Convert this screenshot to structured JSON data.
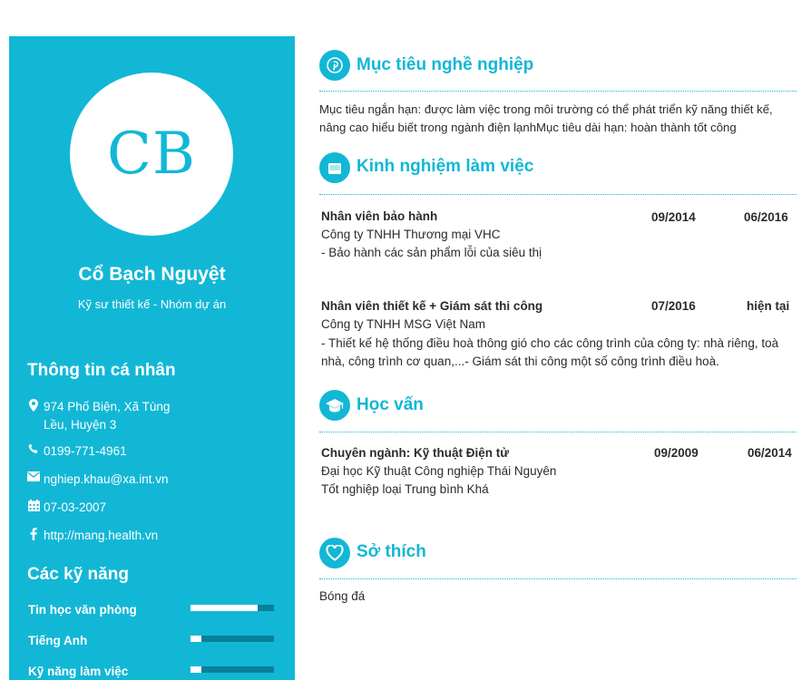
{
  "profile": {
    "initials": "CB",
    "name": "Cổ Bạch Nguyệt",
    "role": "Kỹ sư thiết kế - Nhóm dự án"
  },
  "personal_info": {
    "heading": "Thông tin cá nhân",
    "address_line1": "974 Phố Biện, Xã Tùng",
    "address_line2": "Lều, Huyện 3",
    "phone": "0199-771-4961",
    "email": "nghiep.khau@xa.int.vn",
    "birthdate": "07-03-2007",
    "website": "http://mang.health.vn"
  },
  "skills": {
    "heading": "Các kỹ năng",
    "items": [
      {
        "label": "Tin học văn phòng",
        "level": 0.8
      },
      {
        "label": "Tiếng Anh",
        "level": 0.13
      },
      {
        "label": "Kỹ năng làm việc",
        "level": 0.13
      }
    ]
  },
  "objective": {
    "title": "Mục tiêu nghề nghiệp",
    "text": "Mục tiêu ngắn hạn: được làm việc trong môi trường có thể phát triển kỹ năng thiết kế, nâng cao hiểu biết trong ngành điện lạnhMục tiêu dài hạn: hoàn thành tốt công"
  },
  "experience": {
    "title": "Kinh nghiệm làm việc",
    "jobs": [
      {
        "title": "Nhân viên bảo hành",
        "start": "09/2014",
        "end": "06/2016",
        "company": "Công ty TNHH Thương mại VHC",
        "description": "- Bảo hành các sản phẩm lỗi của siêu thị"
      },
      {
        "title": "Nhân viên thiết kế + Giám sát thi công",
        "start": "07/2016",
        "end": "hiện tại",
        "company": "Công ty TNHH MSG Việt Nam",
        "description": "- Thiết kế hệ thống điều hoà thông gió cho các công trình của công ty: nhà riêng, toà nhà, công trình cơ quan,...- Giám sát thi công một số công trình điều hoà."
      }
    ]
  },
  "education": {
    "title": "Học vấn",
    "major": "Chuyên ngành: Kỹ thuật Điện tử",
    "start": "09/2009",
    "end": "06/2014",
    "school": "Đại học Kỹ thuật Công nghiệp Thái Nguyên",
    "grade": "Tốt nghiệp loại Trung bình Khá"
  },
  "hobbies": {
    "title": "Sở thích",
    "text": "Bóng đá"
  },
  "icons": {
    "objective": "pinterest-icon",
    "experience": "briefcase-icon",
    "education": "graduation-cap-icon",
    "hobbies": "heart-icon",
    "address": "map-marker-icon",
    "phone": "phone-icon",
    "email": "envelope-icon",
    "birthdate": "calendar-icon",
    "website": "facebook-icon"
  },
  "colors": {
    "accent": "#12b7d6",
    "skill_track": "#0a7f99"
  }
}
